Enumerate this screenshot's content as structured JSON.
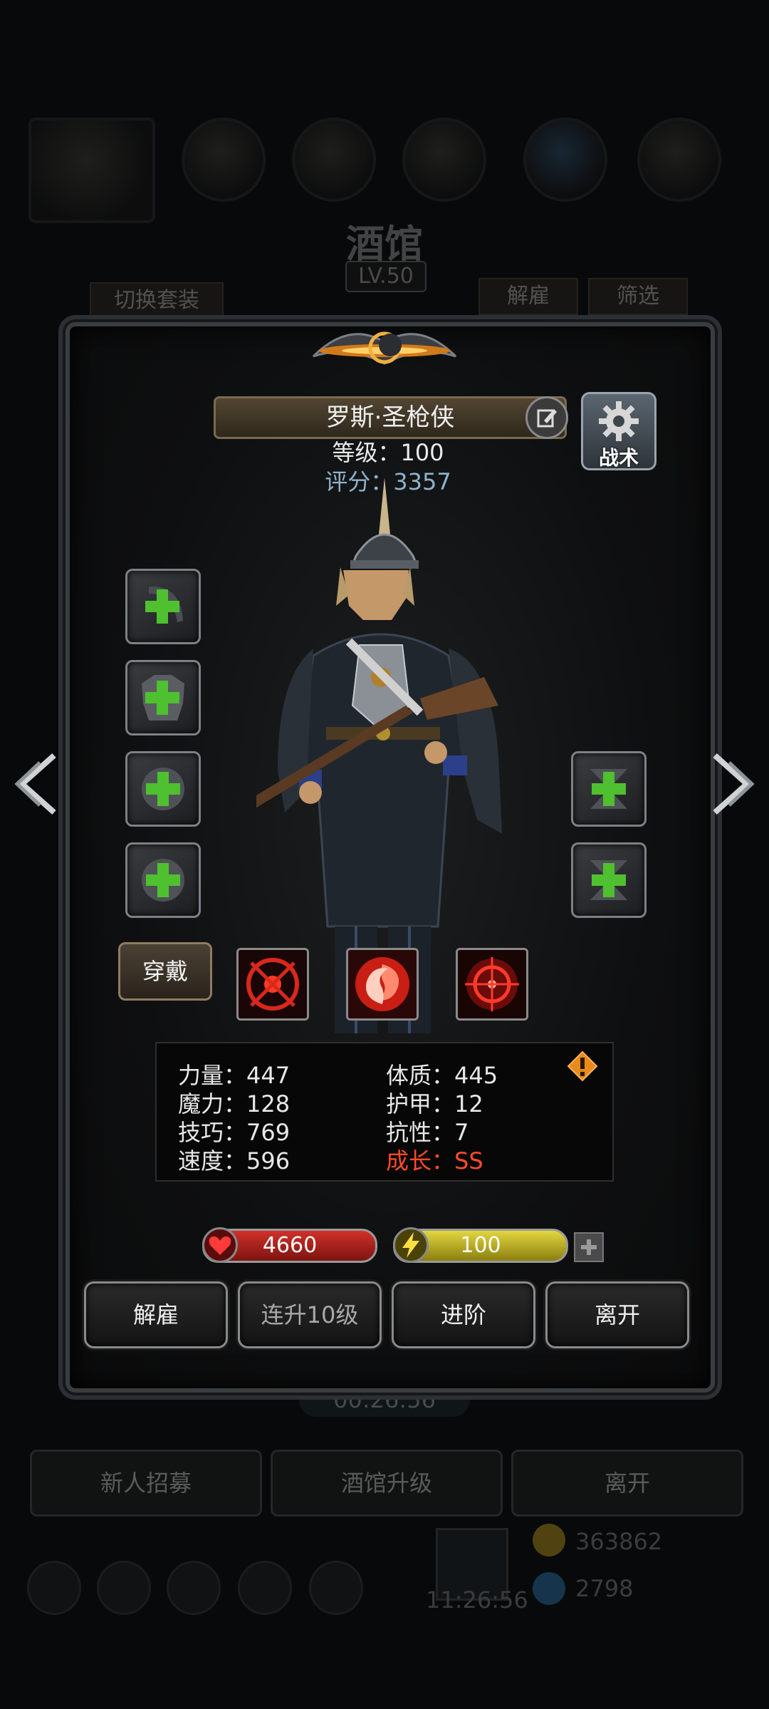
{
  "background": {
    "title": "酒馆",
    "level": "LV.50",
    "switch_outfit": "切换套装",
    "dismiss": "解雇",
    "filter": "筛选",
    "timer": "00:26:56",
    "buttons": [
      "新人招募",
      "酒馆升级",
      "离开"
    ],
    "gold": "363862",
    "gems": "2798",
    "clock": "11:26:56"
  },
  "hero": {
    "name": "罗斯·圣枪侠",
    "level_text": "等级：100",
    "score_text": "评分：3357",
    "tactics_label": "战术",
    "wear_label": "穿戴"
  },
  "stats": [
    {
      "label": "力量：447",
      "highlight": false
    },
    {
      "label": "体质：445",
      "highlight": false
    },
    {
      "label": "魔力：128",
      "highlight": false
    },
    {
      "label": "护甲：12",
      "highlight": false
    },
    {
      "label": "技巧：769",
      "highlight": false
    },
    {
      "label": "抗性：7",
      "highlight": false
    },
    {
      "label": "速度：596",
      "highlight": false
    },
    {
      "label": "成长：SS",
      "highlight": true
    }
  ],
  "bars": {
    "hp": "4660",
    "energy": "100"
  },
  "actions": {
    "dismiss": "解雇",
    "level_up_10": "连升10级",
    "advance": "进阶",
    "leave": "离开"
  },
  "colors": {
    "accent_green": "#4fc02f",
    "growth_red": "#ff4a2a",
    "score_blue": "#8fb2cc"
  }
}
